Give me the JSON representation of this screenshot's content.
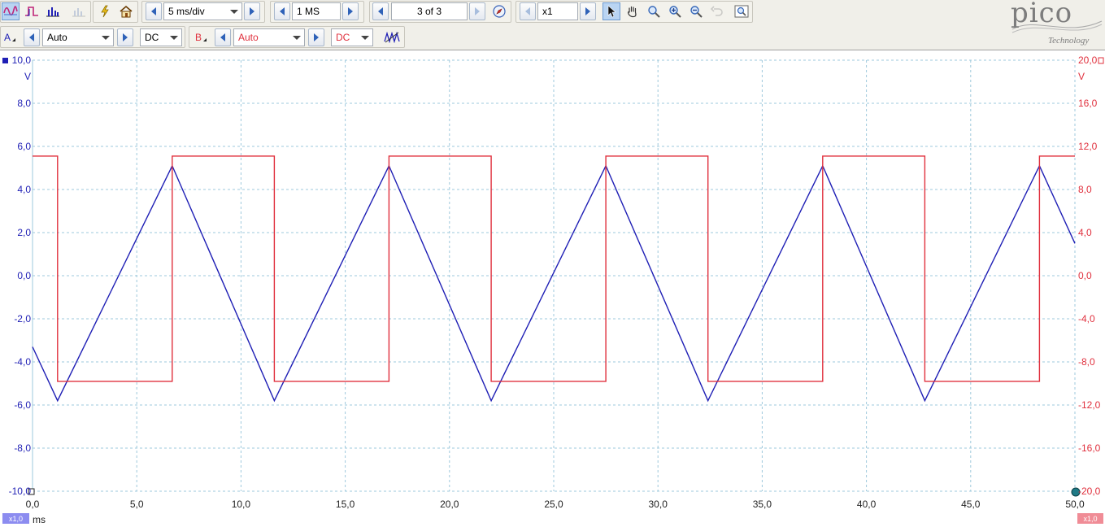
{
  "toolbar": {
    "timebase": {
      "value": "5 ms/div"
    },
    "samples": {
      "value": "1 MS"
    },
    "capture_nav": {
      "value": "3 of 3"
    },
    "zoom": {
      "value": "x1"
    },
    "icons": [
      "scope-mode-icon",
      "persistence-mode-icon",
      "spectrum-mode-icon",
      "spectrum-view-icon",
      "autosetup-lightning-icon",
      "home-icon",
      "compass-icon",
      "select-arrow-icon",
      "hand-pan-icon",
      "zoom-icon",
      "zoom-in-icon",
      "zoom-out-icon",
      "undo-zoom-icon",
      "zoom-overview-icon",
      "math-channel-icon"
    ]
  },
  "channel_a": {
    "label": "A",
    "range": "Auto",
    "coupling": "DC",
    "color": "#1f1fb5"
  },
  "channel_b": {
    "label": "B",
    "range": "Auto",
    "coupling": "DC",
    "color": "#e0303d"
  },
  "logo": {
    "word": "pico",
    "subtitle": "Technology"
  },
  "axes": {
    "y_left_unit": "V",
    "y_right_unit": "V",
    "x_unit": "ms",
    "x_badge": "x1,0",
    "right_badge": "x1,0",
    "y_left_ticks": [
      "10,0",
      "8,0",
      "6,0",
      "4,0",
      "2,0",
      "0,0",
      "-2,0",
      "-4,0",
      "-6,0",
      "-8,0",
      "-10,0"
    ],
    "y_right_ticks": [
      "20,0",
      "16,0",
      "12,0",
      "8,0",
      "4,0",
      "0,0",
      "-4,0",
      "-8,0",
      "-12,0",
      "-16,0",
      "-20,0"
    ],
    "x_ticks": [
      "0,0",
      "5,0",
      "10,0",
      "15,0",
      "20,0",
      "25,0",
      "30,0",
      "35,0",
      "40,0",
      "45,0",
      "50,0"
    ]
  },
  "chart_data": {
    "type": "line",
    "xlabel": "ms",
    "ylabel": "V",
    "xlim": [
      0,
      50
    ],
    "ylim_left": [
      -10,
      10
    ],
    "ylim_right": [
      -20,
      20
    ],
    "grid": true,
    "series": [
      {
        "name": "A",
        "axis": "left",
        "color": "#1f1fb5",
        "x": [
          0,
          1.2,
          6.7,
          11.6,
          17.1,
          22.0,
          27.5,
          32.4,
          37.9,
          42.8,
          48.3,
          50
        ],
        "y": [
          -3.3,
          -5.8,
          5.1,
          -5.8,
          5.1,
          -5.8,
          5.1,
          -5.8,
          5.1,
          -5.8,
          5.1,
          1.5
        ]
      },
      {
        "name": "B",
        "axis": "right",
        "color": "#e0303d",
        "x": [
          0,
          1.2,
          1.2,
          6.7,
          6.7,
          11.6,
          11.6,
          17.1,
          17.1,
          22.0,
          22.0,
          27.5,
          27.5,
          32.4,
          32.4,
          37.9,
          37.9,
          42.8,
          42.8,
          48.3,
          48.3,
          50
        ],
        "y": [
          11.1,
          11.1,
          -9.8,
          -9.8,
          11.1,
          11.1,
          -9.8,
          -9.8,
          11.1,
          11.1,
          -9.8,
          -9.8,
          11.1,
          11.1,
          -9.8,
          -9.8,
          11.1,
          11.1,
          -9.8,
          -9.8,
          11.1,
          11.1
        ]
      }
    ]
  }
}
